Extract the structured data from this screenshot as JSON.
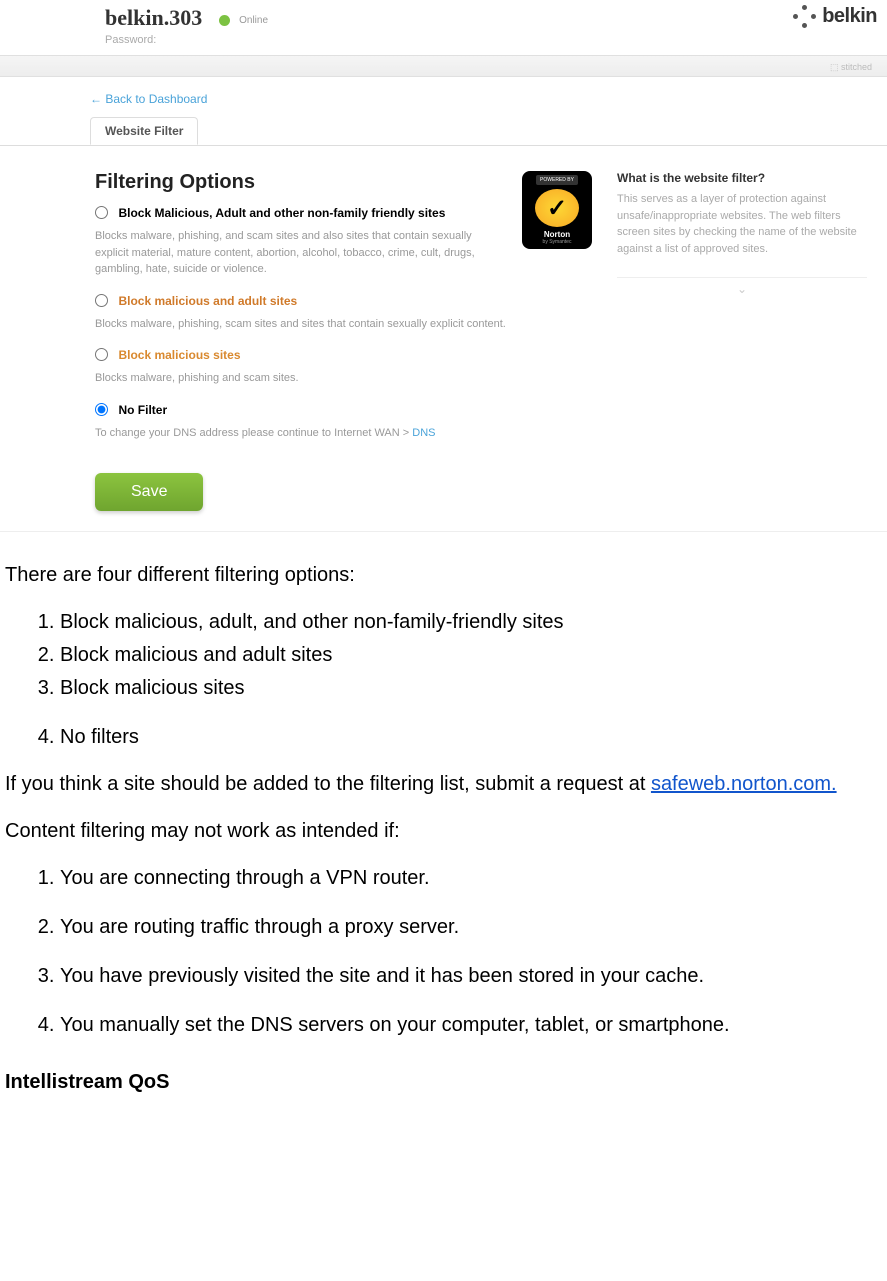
{
  "router": {
    "network_name": "belkin.303",
    "status": "Online",
    "password_label": "Password:",
    "brand": "belkin",
    "gray_stripe_text": "⬚ stitched",
    "back_link": "← Back to Dashboard",
    "tab_label": "Website Filter",
    "section_title": "Filtering Options",
    "norton_powered": "POWERED BY",
    "norton_text": "Norton",
    "norton_sub": "by Symantec",
    "options": [
      {
        "label": "Block Malicious, Adult and other non-family friendly sites",
        "desc": "Blocks malware, phishing, and scam sites and also sites that contain sexually explicit material, mature content, abortion, alcohol, tobacco, crime, cult, drugs, gambling, hate, suicide or violence."
      },
      {
        "label": "Block malicious and adult sites",
        "desc": "Blocks malware, phishing, scam sites and sites that contain sexually explicit content."
      },
      {
        "label": "Block malicious sites",
        "desc": "Blocks malware, phishing and scam sites."
      },
      {
        "label": "No Filter",
        "desc_prefix": "To change your DNS address please continue to Internet WAN > ",
        "desc_link": "DNS"
      }
    ],
    "save_button": "Save",
    "help_title": "What is the website filter?",
    "help_text": "This serves as a layer of protection against unsafe/inappropriate websites. The web filters screen sites by checking the name of the website against a list of approved sites."
  },
  "doc": {
    "intro": "There are four different filtering options:",
    "list1": [
      "Block malicious, adult, and other non-family-friendly sites",
      "Block malicious and adult sites",
      "Block malicious sites",
      "No filters"
    ],
    "submit_prefix": "If you think a site should be added to the filtering list, submit a request at ",
    "submit_link": "safeweb.norton.com.",
    "caveat_intro": "Content filtering may not work as intended if:",
    "list2": [
      "You are connecting through a VPN router.",
      "You are routing traffic through a proxy server.",
      "You have previously visited the site and it has been stored in your cache.",
      "You manually set the DNS servers on your computer, tablet, or smartphone."
    ],
    "next_section": "Intellistream QoS"
  }
}
